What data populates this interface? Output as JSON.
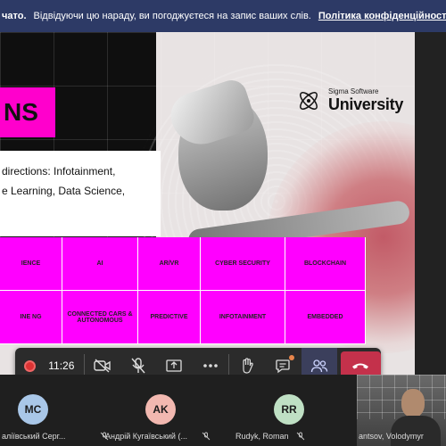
{
  "banner": {
    "bold_text": "чато.",
    "text": "Відвідуючи цю нараду, ви погоджуєтеся на запис ваших слів.",
    "link_label": "Політика конфіденційності"
  },
  "slide": {
    "heading": "NS",
    "logo_sub": "Sigma Software",
    "logo_main": "University",
    "desc_lines": [
      "directions: Infotainment,",
      "e Learning, Data Science,"
    ],
    "grid": [
      "IENCE",
      "AI",
      "AR/VR",
      "CYBER SECURITY",
      "BLOCKCHAIN",
      "INE NG",
      "CONNECTED CARS & AUTONOMOUS",
      "PREDICTIVE",
      "INFOTAINMENT",
      "EMBEDDED"
    ]
  },
  "toolbar": {
    "timer": "11:26",
    "icons": [
      "record-dot-icon",
      "camera-off-icon",
      "mic-off-icon",
      "share-screen-icon",
      "more-icon",
      "raise-hand-icon",
      "chat-icon",
      "people-icon",
      "hang-up-icon"
    ],
    "accent_hangup": "#c4314b"
  },
  "participants": [
    {
      "initials": "MC",
      "name": "аліївський Серг...",
      "color": "#a9c7e8"
    },
    {
      "initials": "AK",
      "name": "Андрій Кугаївський (...",
      "color": "#f2b8b0"
    },
    {
      "initials": "RR",
      "name": "Rudyk, Roman",
      "color": "#bfe0c4"
    },
    {
      "initials": "",
      "name": "antsov, Volodymyr"
    }
  ],
  "colors": {
    "magenta": "#ff00ff",
    "banner": "#2d3a66"
  }
}
